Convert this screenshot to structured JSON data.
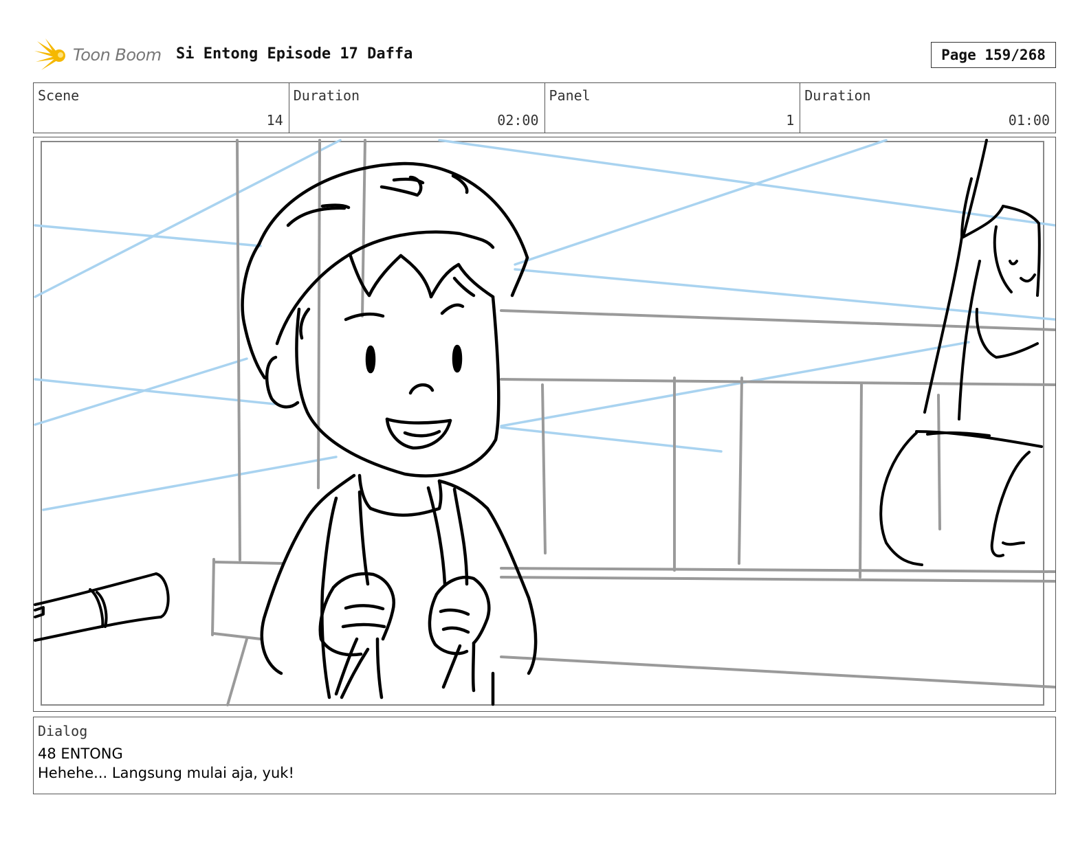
{
  "header": {
    "logo_text": "Toon Boom",
    "title": "Si Entong Episode 17 Daffa",
    "page": "Page 159/268"
  },
  "info": {
    "scene_label": "Scene",
    "scene_value": "14",
    "scene_duration_label": "Duration",
    "scene_duration_value": "02:00",
    "panel_label": "Panel",
    "panel_value": "1",
    "panel_duration_label": "Duration",
    "panel_duration_value": "01:00"
  },
  "dialog": {
    "label": "Dialog",
    "speaker": "48 ENTONG",
    "line": "Hehehe... Langsung mulai aja, yuk!"
  },
  "colors": {
    "sketch_blue": "#a9d3f0",
    "sketch_grey": "#9a9a9a",
    "ink": "#000000",
    "logo_yellow": "#f5b800"
  }
}
